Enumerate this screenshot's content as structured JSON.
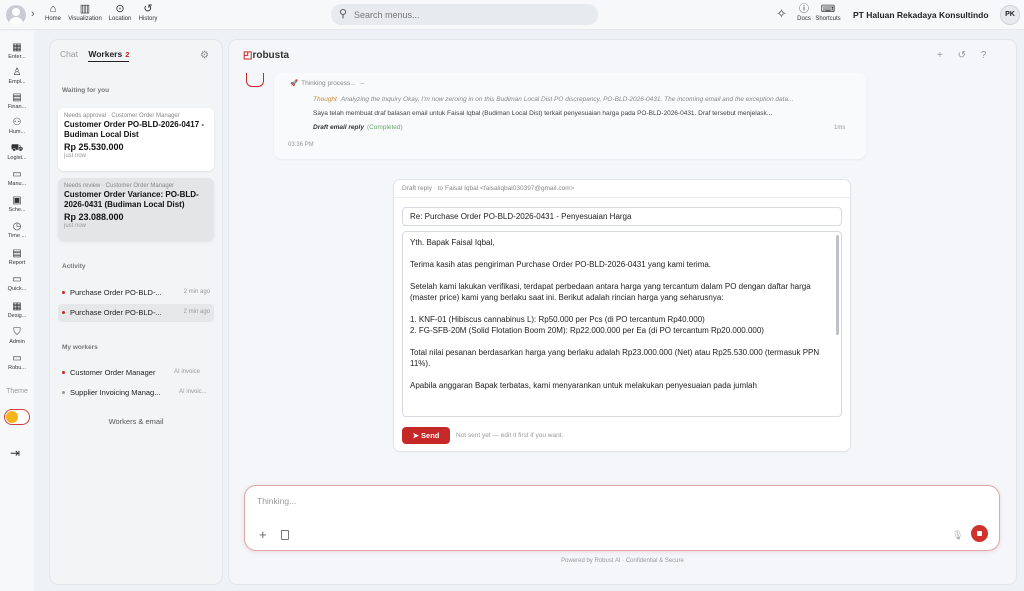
{
  "topbar": {
    "nav": [
      {
        "label": "Home",
        "icon": "home-icon"
      },
      {
        "label": "Visualization",
        "icon": "chart-icon"
      },
      {
        "label": "Location",
        "icon": "pin-icon"
      },
      {
        "label": "History",
        "icon": "history-icon"
      }
    ],
    "search_placeholder": "Search menus...",
    "docs_label": "Docs",
    "shortcuts_label": "Shortcuts",
    "company": "PT Haluan Rekadaya Konsultindo",
    "user_initials": "PK"
  },
  "rail": {
    "items": [
      "Enter...",
      "Empl...",
      "Finan...",
      "Hum...",
      "Logist...",
      "Manu...",
      "Sche...",
      "Time ...",
      "Report",
      "Quick...",
      "Desig...",
      "Admin",
      "Robu..."
    ],
    "theme_label": "Theme"
  },
  "left": {
    "tab_chat": "Chat",
    "tab_workers": "Workers",
    "workers_count": "2",
    "waiting_title": "Waiting for you",
    "cards": [
      {
        "meta": "Needs approval · Customer Order Manager",
        "title": "Customer Order PO-BLD-2026-0417 - Budiman Local Dist",
        "amount": "Rp 25.530.000",
        "time": "just now"
      },
      {
        "meta": "Needs review · Customer Order Manager",
        "title": "Customer Order Variance: PO-BLD-2026-0431 (Budiman Local Dist)",
        "amount": "Rp 23.088.000",
        "time": "just now"
      }
    ],
    "activity_title": "Activity",
    "activity": [
      {
        "label": "Purchase Order PO-BLD-...",
        "ago": "2 min ago"
      },
      {
        "label": "Purchase Order PO-BLD-...",
        "ago": "2 min ago"
      }
    ],
    "myworkers_title": "My workers",
    "workers": [
      {
        "label": "Customer Order Manager",
        "tag": "AI invoice"
      },
      {
        "label": "Supplier Invoicing Manag...",
        "tag": "AI invoic..."
      }
    ],
    "workers_email": "Workers & email"
  },
  "main": {
    "logo": "robusta",
    "thinking_label": "Thinking process...",
    "thinking_collapse": "–",
    "thought_label": "Thought",
    "thought_text": "Analyzing the Inquiry Okay, I'm now zeroing in on this Budiman Local Dist PO discrepancy, PO-BLD-2026-0431. The incoming email and the exception data...",
    "step_text": "Saya telah membuat draf balasan email untuk Faisal Iqbal (Budiman Local Dist) terkait penyesuaian harga pada PO-BLD-2026-0431. Draf tersebut menjelask...",
    "draft_step": "Draft email reply",
    "draft_status": "(Completed)",
    "duration": "1ms",
    "msg_time": "03:36 PM"
  },
  "draft": {
    "header": "Draft reply · to Faisal Iqbal <faisaliqbal030397@gmail.com>",
    "subject": "Re: Purchase Order PO-BLD-2026-0431 - Penyesuaian Harga",
    "body": [
      "Yth. Bapak Faisal Iqbal,",
      "Terima kasih atas pengiriman Purchase Order PO-BLD-2026-0431 yang kami terima.",
      "Setelah kami lakukan verifikasi, terdapat perbedaan antara harga yang tercantum dalam PO dengan daftar harga (master price) kami yang berlaku saat ini. Berikut adalah rincian harga yang seharusnya:",
      "1. KNF-01 (Hibiscus cannabinus L): Rp50.000 per Pcs (di PO tercantum Rp40.000)",
      "2. FG-SFB-20M (Solid Flotation Boom 20M): Rp22.000.000 per Ea (di PO tercantum Rp20.000.000)",
      "Total nilai pesanan berdasarkan harga yang berlaku adalah Rp23.000.000 (Net) atau Rp25.530.000 (termasuk PPN 11%).",
      "Apabila anggaran Bapak terbatas, kami menyarankan untuk melakukan penyesuaian pada jumlah"
    ],
    "send_label": "Send",
    "send_note": "Not sent yet — edit it first if you want."
  },
  "composer": {
    "placeholder": "Thinking...",
    "footer": "Powered by Robust AI · Confidential & Secure"
  }
}
